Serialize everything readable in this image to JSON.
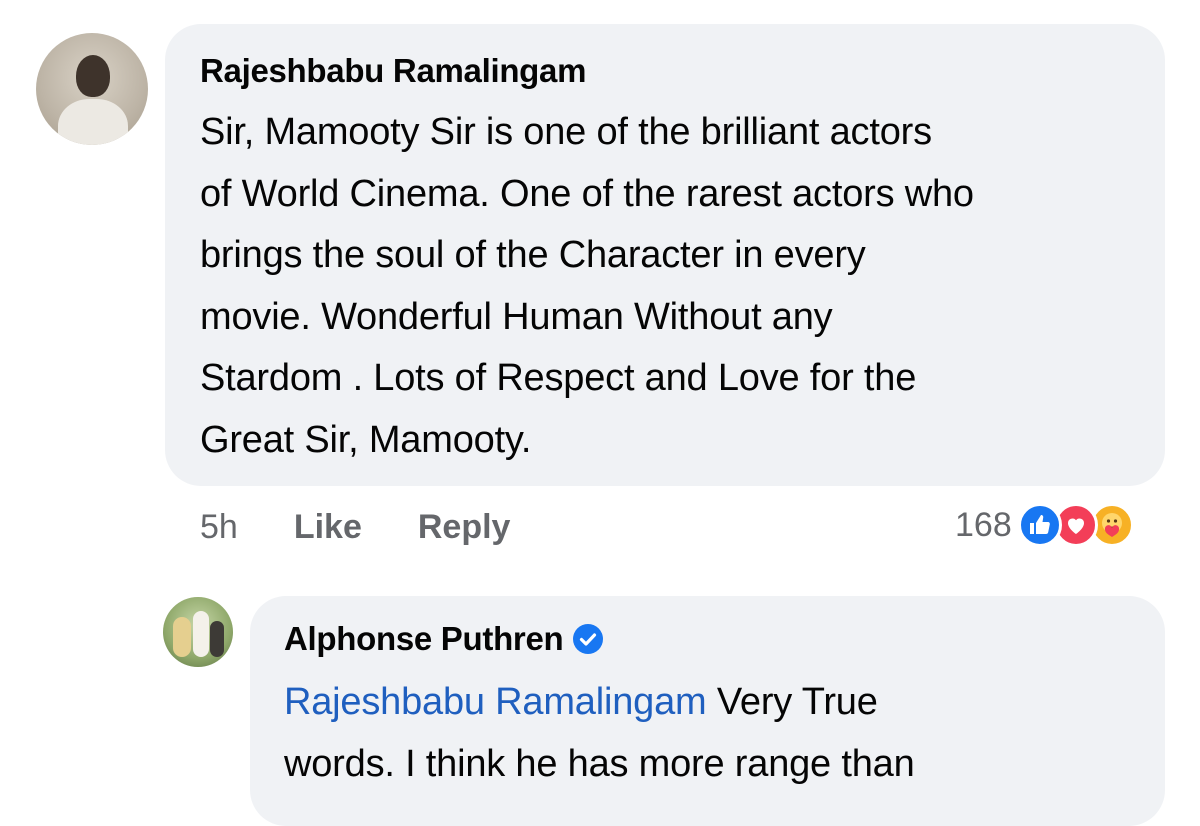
{
  "comment": {
    "author": "Rajeshbabu Ramalingam",
    "text": "Sir, Mamooty Sir is one of the brilliant  actors\nof World Cinema. One of the rarest actors who\nbrings the soul of the Character in every\nmovie. Wonderful Human Without any\nStardom . Lots of Respect and Love for the\nGreat Sir, Mamooty.",
    "time": "5h",
    "like_label": "Like",
    "reply_label": "Reply",
    "reaction_count": "168",
    "reactions": [
      "like-icon",
      "love-icon",
      "care-icon"
    ]
  },
  "reply": {
    "author": "Alphonse Puthren",
    "verified": true,
    "mention": "Rajeshbabu Ramalingam",
    "text_after_mention": " Very True\nwords. I think he has more range than"
  },
  "colors": {
    "bubble": "#f0f2f5",
    "mention": "#1f5fbf",
    "meta": "#65676b",
    "like_blue": "#1877f2",
    "love_red": "#f33e58",
    "care_yellow": "#f7b125"
  }
}
